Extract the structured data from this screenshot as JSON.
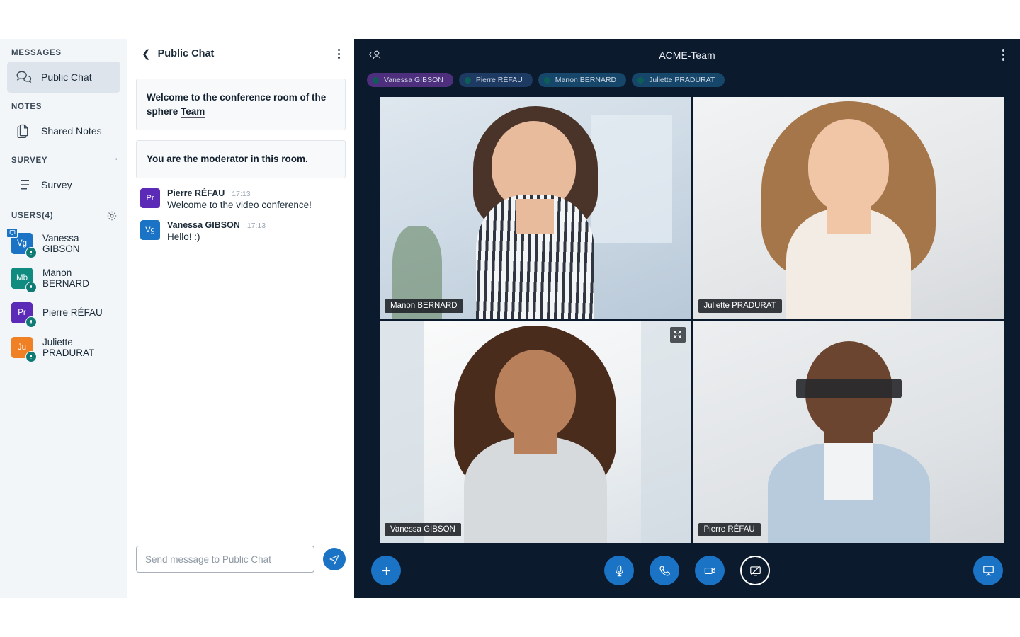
{
  "sidebar": {
    "sections": [
      {
        "title": "MESSAGES"
      },
      {
        "title": "NOTES"
      },
      {
        "title": "SURVEY"
      }
    ],
    "messages_label": "MESSAGES",
    "notes_label": "NOTES",
    "survey_label": "SURVEY",
    "public_chat_label": "Public Chat",
    "shared_notes_label": "Shared Notes",
    "survey_item_label": "Survey",
    "users_label": "USERS(4)",
    "users": [
      {
        "name": "Vanessa GIBSON",
        "initials": "Vg",
        "color": "#1a73c4",
        "muted": true,
        "sharing": true
      },
      {
        "name": "Manon BERNARD",
        "initials": "Mb",
        "color": "#0f8b80",
        "muted": true,
        "sharing": false
      },
      {
        "name": "Pierre RÉFAU",
        "initials": "Pr",
        "color": "#5b2bb8",
        "muted": true,
        "sharing": false
      },
      {
        "name": "Juliette PRADURAT",
        "initials": "Ju",
        "color": "#ef8024",
        "muted": true,
        "sharing": false
      }
    ]
  },
  "chat": {
    "title": "Public Chat",
    "back_icon": "chevron-left-icon",
    "menu_icon": "kebab-menu-icon",
    "notices": [
      {
        "text_a": "Welcome to the conference room of the sphere ",
        "text_b": "Team"
      },
      {
        "text_a": "You are the moderator in this room.",
        "text_b": ""
      }
    ],
    "notice_1_line1": "Welcome to the conference room of the sphere",
    "notice_1_line2": "Team",
    "notice_2": "You are the moderator in this room.",
    "messages": [
      {
        "name": "Pierre RÉFAU",
        "initials": "Pr",
        "color": "#5b2bb8",
        "time": "17:13",
        "text": "Welcome to the video conference!"
      },
      {
        "name": "Vanessa GIBSON",
        "initials": "Vg",
        "color": "#1a73c4",
        "time": "17:13",
        "text": "Hello! :)"
      }
    ],
    "input_placeholder": "Send message to Public Chat",
    "input_value": "",
    "send_icon": "send-icon"
  },
  "video": {
    "title": "ACME-Team",
    "people_icon": "people-back-icon",
    "menu_icon": "kebab-menu-icon",
    "chips": [
      {
        "label": "Vanessa GIBSON",
        "bg": "#4d2f7d"
      },
      {
        "label": "Pierre  RÉFAU",
        "bg": "#1d3a63"
      },
      {
        "label": "Manon BERNARD",
        "bg": "#16476b"
      },
      {
        "label": "Juliette PRADURAT",
        "bg": "#16476b"
      }
    ],
    "tiles": [
      {
        "label": "Manon BERNARD",
        "active": false,
        "expandable": false
      },
      {
        "label": "Juliette PRADURAT",
        "active": false,
        "expandable": false
      },
      {
        "label": "Vanessa GIBSON",
        "active": true,
        "expandable": true
      },
      {
        "label": "Pierre RÉFAU",
        "active": false,
        "expandable": false
      }
    ],
    "controls": {
      "add": {
        "name": "add-button",
        "icon": "plus-icon"
      },
      "mic": {
        "name": "microphone-button",
        "icon": "microphone-icon"
      },
      "phone": {
        "name": "hangup-button",
        "icon": "phone-icon"
      },
      "camera": {
        "name": "camera-button",
        "icon": "video-camera-icon"
      },
      "screenshare": {
        "name": "screenshare-button",
        "icon": "screen-share-off-icon"
      },
      "presentation": {
        "name": "presentation-button",
        "icon": "presentation-board-icon"
      }
    }
  },
  "colors": {
    "accent": "#1a73c4",
    "panel_dark": "#0c1a2e",
    "sidebar_bg": "#f3f6f9",
    "active_tile_border": "#2a6fd6"
  }
}
